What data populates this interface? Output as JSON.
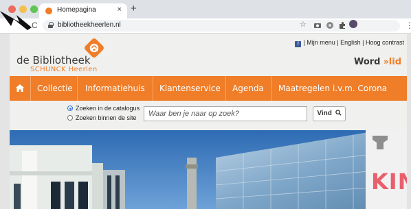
{
  "browser": {
    "tab_title": "Homepagina",
    "tab_close": "×",
    "new_tab": "+",
    "reload": "C",
    "url": "bibliotheekheerlen.nl",
    "star": "☆",
    "menu": "⋮"
  },
  "site": {
    "logo_line1": "de Bibliotheek",
    "logo_line2": "SCHUNCK  Heerlen",
    "toplinks": "| Mijn menu | English | Hoog contrast",
    "fb": "f",
    "word": "Word",
    "arrow": "»",
    "lid": "lid",
    "nav": [
      {
        "label": "Collectie"
      },
      {
        "label": "Informatiehuis"
      },
      {
        "label": "Klantenservice"
      },
      {
        "label": "Agenda"
      },
      {
        "label": "Maatregelen i.v.m. Corona"
      }
    ],
    "search": {
      "radio_catalogus": "Zoeken in de catalogus",
      "radio_site": "Zoeken binnen de site",
      "placeholder": "Waar ben je naar op zoek?",
      "button": "Vind"
    },
    "hero_sign": "KIN"
  },
  "colors": {
    "brand_orange": "#f07d28",
    "text_dark": "#3a3a3a",
    "sky_blue": "#3c7fc5"
  }
}
